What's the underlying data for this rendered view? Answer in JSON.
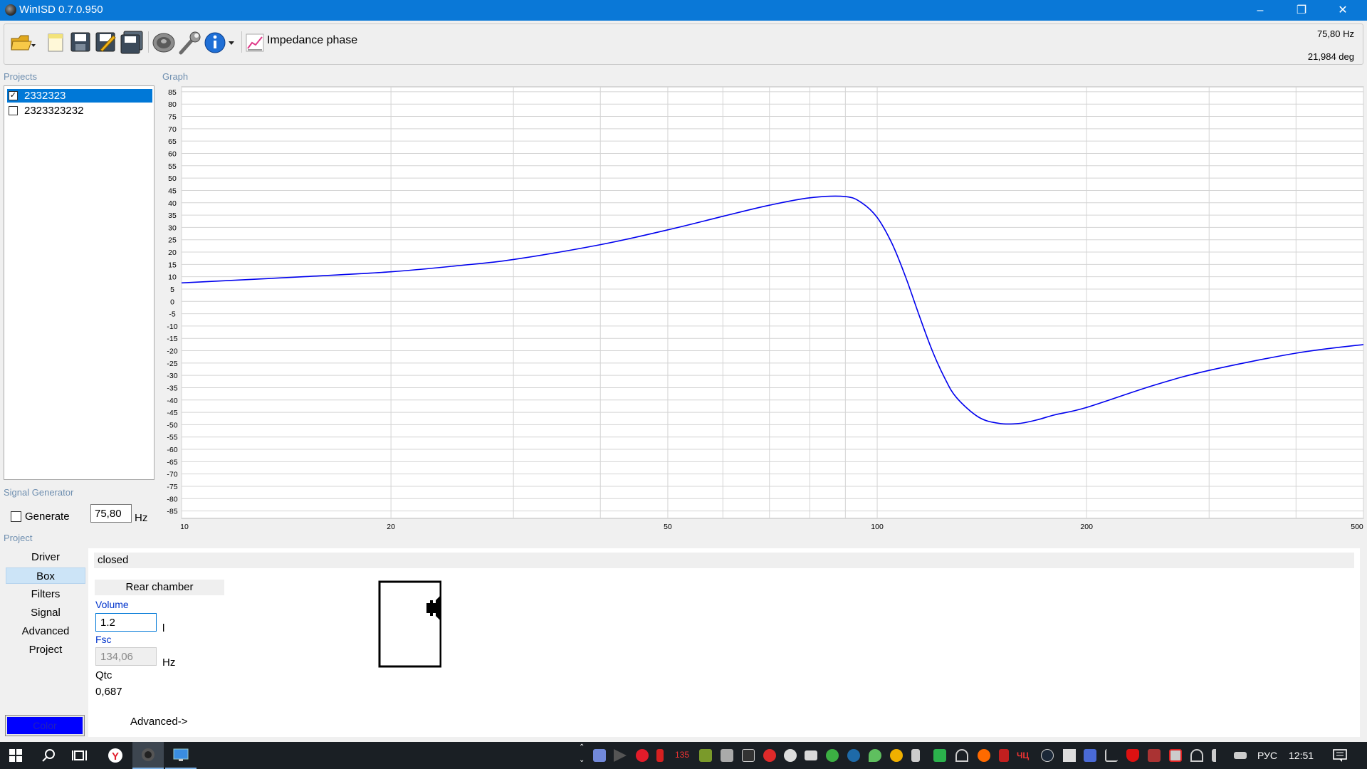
{
  "window": {
    "title": "WinISD 0.7.0.950"
  },
  "toolbar": {
    "graph_select_label": "Impedance phase",
    "readout_freq": "75,80 Hz",
    "readout_value": "21,984 deg"
  },
  "sections": {
    "projects": "Projects",
    "graph": "Graph",
    "signal_generator": "Signal Generator",
    "project": "Project"
  },
  "projects": [
    {
      "name": "2332323",
      "checked": true,
      "selected": true
    },
    {
      "name": "2323323232",
      "checked": false,
      "selected": false
    }
  ],
  "signal_generator": {
    "generate_label": "Generate",
    "generate_checked": false,
    "frequency_value": "75,80",
    "unit": "Hz"
  },
  "chart_data": {
    "type": "line",
    "title": "",
    "xlabel": "",
    "ylabel": "",
    "x_scale": "log",
    "xlim": [
      10,
      500
    ],
    "ylim": [
      -88,
      87
    ],
    "x_ticks_major": [
      {
        "value": 10,
        "label": "10"
      },
      {
        "value": 20,
        "label": "20"
      },
      {
        "value": 50,
        "label": "50"
      },
      {
        "value": 100,
        "label": "100"
      },
      {
        "value": 200,
        "label": "200"
      },
      {
        "value": 500,
        "label": "500"
      }
    ],
    "x_grid": [
      10,
      20,
      30,
      40,
      50,
      60,
      70,
      80,
      90,
      100,
      200,
      300,
      400,
      500
    ],
    "y_ticks": [
      85,
      80,
      75,
      70,
      65,
      60,
      55,
      50,
      45,
      40,
      35,
      30,
      25,
      20,
      15,
      10,
      5,
      0,
      -5,
      -10,
      -15,
      -20,
      -25,
      -30,
      -35,
      -40,
      -45,
      -50,
      -55,
      -60,
      -65,
      -70,
      -75,
      -80,
      -85
    ],
    "grid": true,
    "series": [
      {
        "color": "#0000ee",
        "x": [
          10,
          15,
          20,
          25,
          30,
          40,
          50,
          60,
          70,
          80,
          90,
          95,
          100,
          105,
          110,
          115,
          120,
          125,
          130,
          140,
          150,
          160,
          170,
          180,
          200,
          250,
          300,
          400,
          500
        ],
        "y": [
          7.5,
          10,
          12,
          14.5,
          17,
          23,
          29,
          34.5,
          39,
          42,
          42.5,
          40,
          34,
          23.5,
          9.5,
          -6,
          -20,
          -31,
          -39,
          -47,
          -49.5,
          -49.5,
          -48,
          -46,
          -43,
          -34,
          -28,
          -21,
          -17.5
        ]
      }
    ]
  },
  "project_nav": [
    {
      "label": "Driver",
      "active": false
    },
    {
      "label": "Box",
      "active": true
    },
    {
      "label": "Filters",
      "active": false
    },
    {
      "label": "Signal",
      "active": false
    },
    {
      "label": "Advanced",
      "active": false
    },
    {
      "label": "Project",
      "active": false
    }
  ],
  "color_button": {
    "label": "Color",
    "color": "#0000ff"
  },
  "box": {
    "type": "closed",
    "chamber_label": "Rear chamber",
    "volume_label": "Volume",
    "volume_value": "1.2",
    "volume_unit": "l",
    "fsc_label": "Fsc",
    "fsc_value": "134,06",
    "fsc_unit": "Hz",
    "qtc_label": "Qtc",
    "qtc_value": "0,687",
    "advanced_link": "Advanced->"
  },
  "taskbar": {
    "language": "РУС",
    "time": "12:51",
    "tray_badge": "135"
  }
}
